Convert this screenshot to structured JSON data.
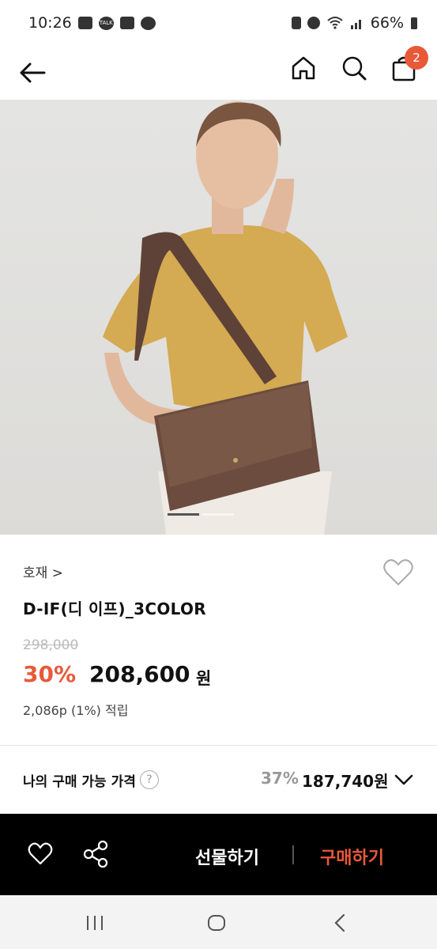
{
  "status_bar": {
    "time": "10:26",
    "talk_label": "TALK",
    "battery": "66%"
  },
  "header": {
    "cart_count": "2"
  },
  "product": {
    "brand": "호재 >",
    "name": "D-IF(디 이프)_3COLOR",
    "original_price": "298,000",
    "discount_rate": "30%",
    "sale_price": "208,600",
    "currency": "원",
    "points": "2,086p (1%) 적립"
  },
  "my_price": {
    "label": "나의 구매 가능 가격",
    "help": "?",
    "rate": "37%",
    "price": "187,740원"
  },
  "actions": {
    "gift": "선물하기",
    "buy": "구매하기"
  },
  "colors": {
    "accent": "#e8593a",
    "bar": "#000000"
  }
}
